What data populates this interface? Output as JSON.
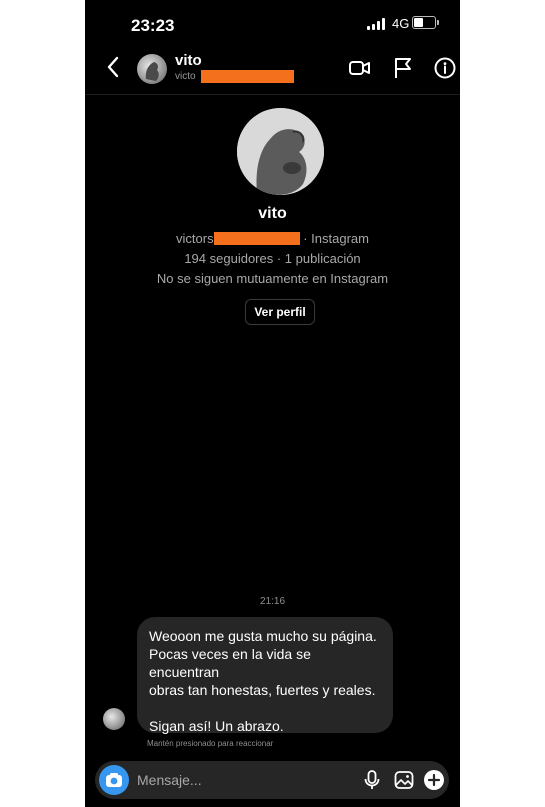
{
  "status_bar": {
    "time": "23:23",
    "network": "4G"
  },
  "header": {
    "name": "vito",
    "username_visible": "victo"
  },
  "profile": {
    "name": "vito",
    "username_visible": "victors",
    "username_suffix": "· Instagram",
    "followers_line": "194 seguidores · 1 publicación",
    "mutual_line": "No se siguen mutuamente en Instagram",
    "view_profile_label": "Ver perfil"
  },
  "conversation": {
    "timestamp": "21:16",
    "message_lines": [
      "Weooon me gusta mucho su página.",
      "Pocas veces en la vida se encuentran",
      "obras tan honestas, fuertes y reales.",
      "Sigan así! Un abrazo."
    ],
    "reaction_hint": "Mantén presionado para reaccionar"
  },
  "composer": {
    "placeholder": "Mensaje..."
  },
  "colors": {
    "background": "#000000",
    "bubble": "#262626",
    "accent": "#3797f0",
    "redaction": "#f4701c"
  },
  "icons": [
    "back-arrow-icon",
    "video-call-icon",
    "flag-icon",
    "info-icon",
    "camera-icon",
    "microphone-icon",
    "gallery-icon",
    "plus-icon"
  ]
}
